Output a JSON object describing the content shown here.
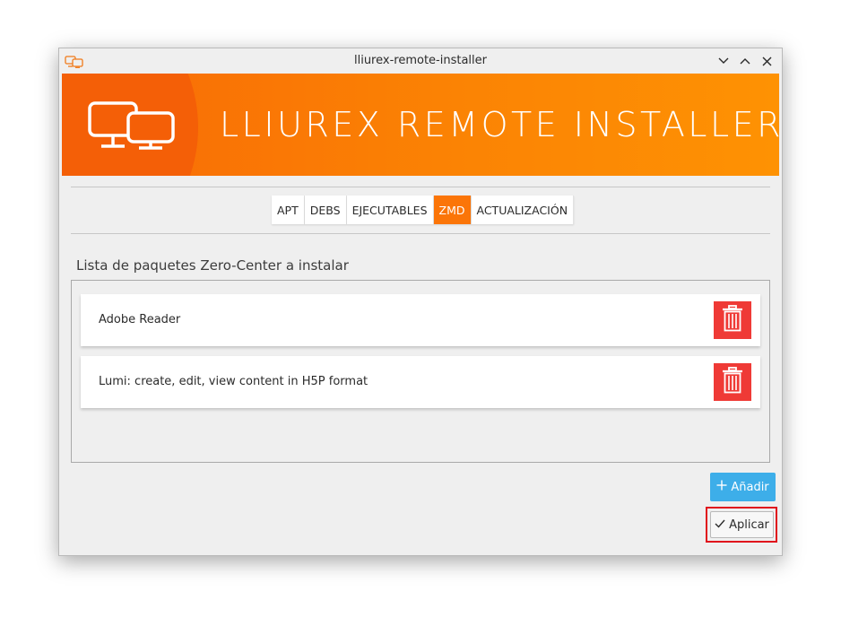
{
  "window": {
    "title": "lliurex-remote-installer",
    "controls": [
      "minimize",
      "maximize",
      "close"
    ]
  },
  "banner": {
    "title": "LLIUREX REMOTE INSTALLER",
    "icon": "two-monitors-icon"
  },
  "tabs": [
    {
      "label": "APT",
      "active": false
    },
    {
      "label": "DEBS",
      "active": false
    },
    {
      "label": "EJECUTABLES",
      "active": false
    },
    {
      "label": "ZMD",
      "active": true
    },
    {
      "label": "ACTUALIZACIÓN",
      "active": false
    }
  ],
  "section": {
    "label": "Lista de paquetes Zero-Center a instalar"
  },
  "packages": [
    {
      "name": "Adobe Reader"
    },
    {
      "name": "Lumi: create, edit, view content in H5P format"
    }
  ],
  "actions": {
    "add_label": "Añadir",
    "apply_label": "Aplicar"
  },
  "colors": {
    "accent": "#fb7508",
    "delete": "#ef3a36",
    "add_button": "#3daee9",
    "highlight": "#e0111c"
  }
}
